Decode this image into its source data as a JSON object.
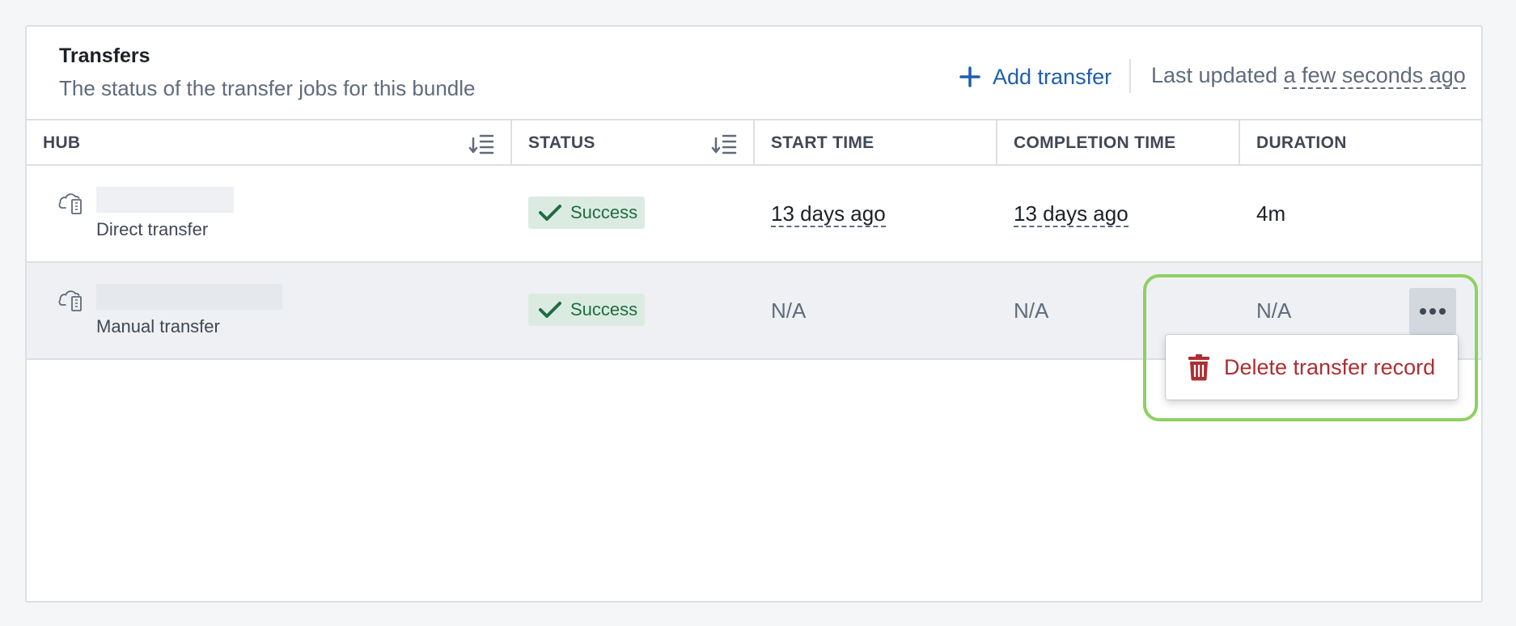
{
  "header": {
    "title": "Transfers",
    "subtitle": "The status of the transfer jobs for this bundle",
    "add_label": "Add transfer",
    "updated_prefix": "Last updated",
    "updated_relative": "a few seconds ago"
  },
  "columns": {
    "hub": "HUB",
    "status": "STATUS",
    "start": "START TIME",
    "completion": "COMPLETION TIME",
    "duration": "DURATION"
  },
  "rows": [
    {
      "hub_type": "Direct transfer",
      "status": "Success",
      "start_time": "13 days ago",
      "completion_time": "13 days ago",
      "duration": "4m"
    },
    {
      "hub_type": "Manual transfer",
      "status": "Success",
      "start_time": "N/A",
      "completion_time": "N/A",
      "duration": "N/A"
    }
  ],
  "menu": {
    "delete_label": "Delete transfer record"
  },
  "icons": {
    "add": "plus-icon",
    "sort": "sort-icon",
    "hub": "cloud-server-icon",
    "status": "check-icon",
    "more": "more-icon",
    "delete": "trash-icon"
  },
  "colors": {
    "accent": "#215db0",
    "success_bg": "#dcebe1",
    "success_text": "#1c6e42",
    "danger": "#ac2f33",
    "highlight": "#8ed062"
  }
}
